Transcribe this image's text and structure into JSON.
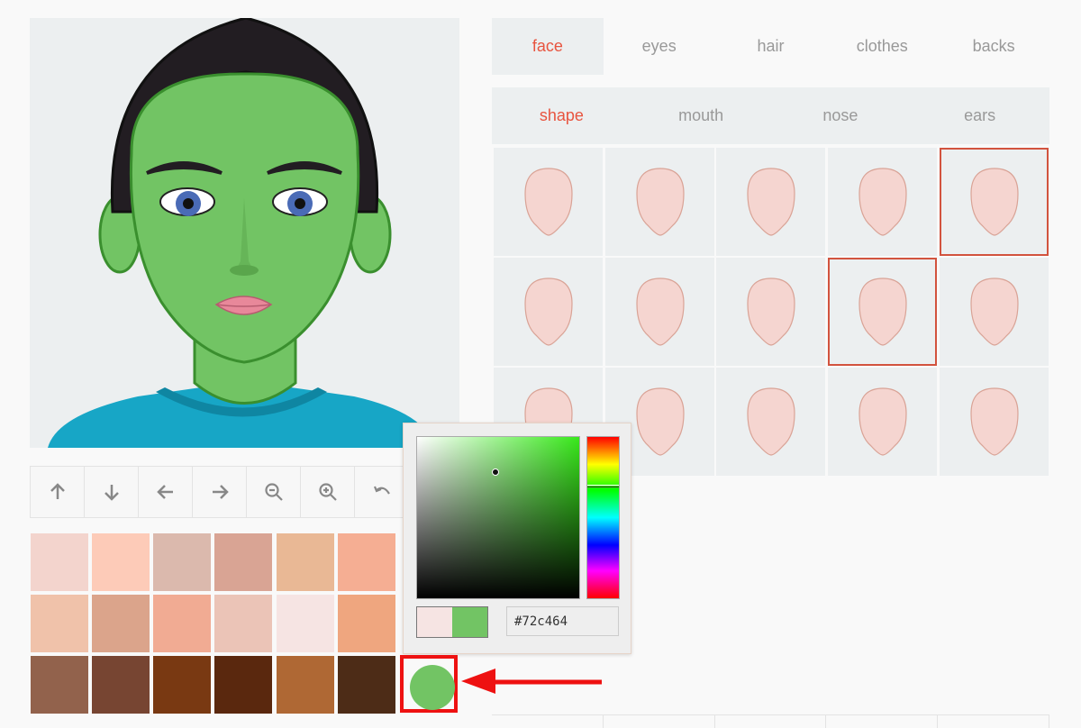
{
  "tabs": [
    "face",
    "eyes",
    "hair",
    "clothes",
    "backs"
  ],
  "active_tab": "face",
  "subtabs": [
    "shape",
    "mouth",
    "nose",
    "ears"
  ],
  "active_subtab": "shape",
  "toolbar": [
    "arrow-up-icon",
    "arrow-down-icon",
    "arrow-left-icon",
    "arrow-right-icon",
    "zoom-out-icon",
    "zoom-in-icon",
    "undo-icon"
  ],
  "skin_swatches": [
    [
      "#f3d4cd",
      "#fdcbb8",
      "#dbb9ad",
      "#d9a494",
      "#e9b895",
      "#f5ae93"
    ],
    [
      "#f0c2aa",
      "#dba48b",
      "#f1ab93",
      "#ebc4b7",
      "#f6e4e3",
      "#efa67f"
    ],
    [
      "#92624c",
      "#774532",
      "#793912",
      "#5a280e",
      "#af6834",
      "#4d2c17"
    ]
  ],
  "selected_shapes": [
    4,
    8
  ],
  "color_picker": {
    "hex_value": "#72c464",
    "previous_color": "#f6e4e3",
    "new_color": "#72c464",
    "hue_color": "#38e81b"
  },
  "avatar": {
    "skin_color": "#72c464",
    "hair_color": "#221d22",
    "shirt_color": "#17a6c6",
    "eye_color": "#4a6bb6",
    "lip_color": "#e8889a"
  },
  "face_shape_fill": "#f5d5d0",
  "annotation_color": "#ee1111"
}
